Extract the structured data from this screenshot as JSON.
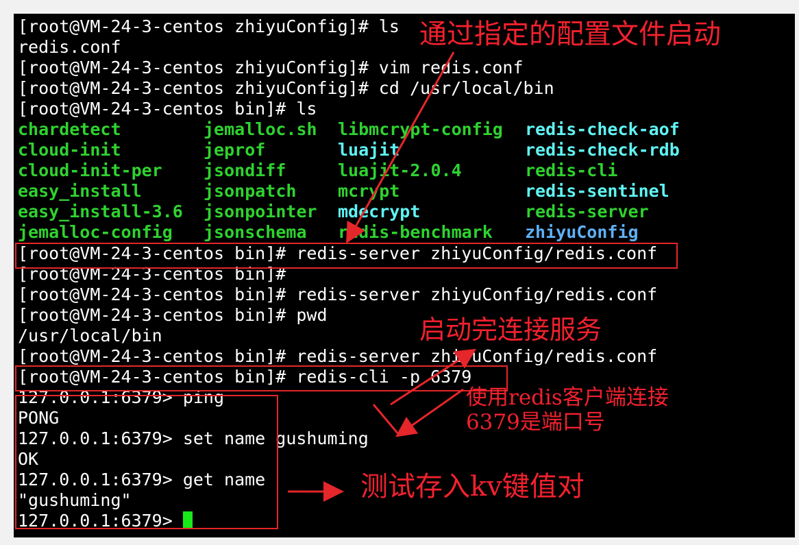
{
  "terminal": {
    "lines": [
      "[root@VM-24-3-centos zhiyuConfig]# ls",
      "redis.conf",
      "[root@VM-24-3-centos zhiyuConfig]# vim redis.conf",
      "[root@VM-24-3-centos zhiyuConfig]# cd /usr/local/bin",
      "[root@VM-24-3-centos bin]# ls",
      "[root@VM-24-3-centos bin]# redis-server zhiyuConfig/redis.conf",
      "[root@VM-24-3-centos bin]#",
      "[root@VM-24-3-centos bin]# redis-server zhiyuConfig/redis.conf",
      "[root@VM-24-3-centos bin]# pwd",
      "/usr/local/bin",
      "[root@VM-24-3-centos bin]# redis-server zhiyuConfig/redis.conf",
      "[root@VM-24-3-centos bin]# redis-cli -p 6379",
      "127.0.0.1:6379> ping",
      "PONG",
      "127.0.0.1:6379> set name gushuming",
      "OK",
      "127.0.0.1:6379> get name",
      "\"gushuming\"",
      "127.0.0.1:6379> "
    ],
    "ls_columns": [
      [
        "chardetect",
        "cloud-init",
        "cloud-init-per",
        "easy_install",
        "easy_install-3.6",
        "jemalloc-config"
      ],
      [
        "jemalloc.sh",
        "jeprof",
        "jsondiff",
        "jsonpatch",
        "jsonpointer",
        "jsonschema"
      ],
      [
        "libmcrypt-config",
        "luajit",
        "luajit-2.0.4",
        "mcrypt",
        "mdecrypt",
        "redis-benchmark"
      ],
      [
        "redis-check-aof",
        "redis-check-rdb",
        "redis-cli",
        "redis-sentinel",
        "redis-server",
        "zhiyuConfig"
      ]
    ],
    "colors": {
      "background": "#000000",
      "text": "#ffffff",
      "exec": "#2fd22f",
      "link": "#5ff3f3",
      "dir": "#5fb0f5",
      "cursor": "#19e819"
    }
  },
  "annotations": {
    "config_start": "通过指定的配置文件启动",
    "connect_service": "启动完连接服务",
    "client_connect_1": "使用redis客户端连接",
    "client_connect_2": "6379是端口号",
    "test_kv": "测试存入kv键值对",
    "color": "#f2212e"
  }
}
